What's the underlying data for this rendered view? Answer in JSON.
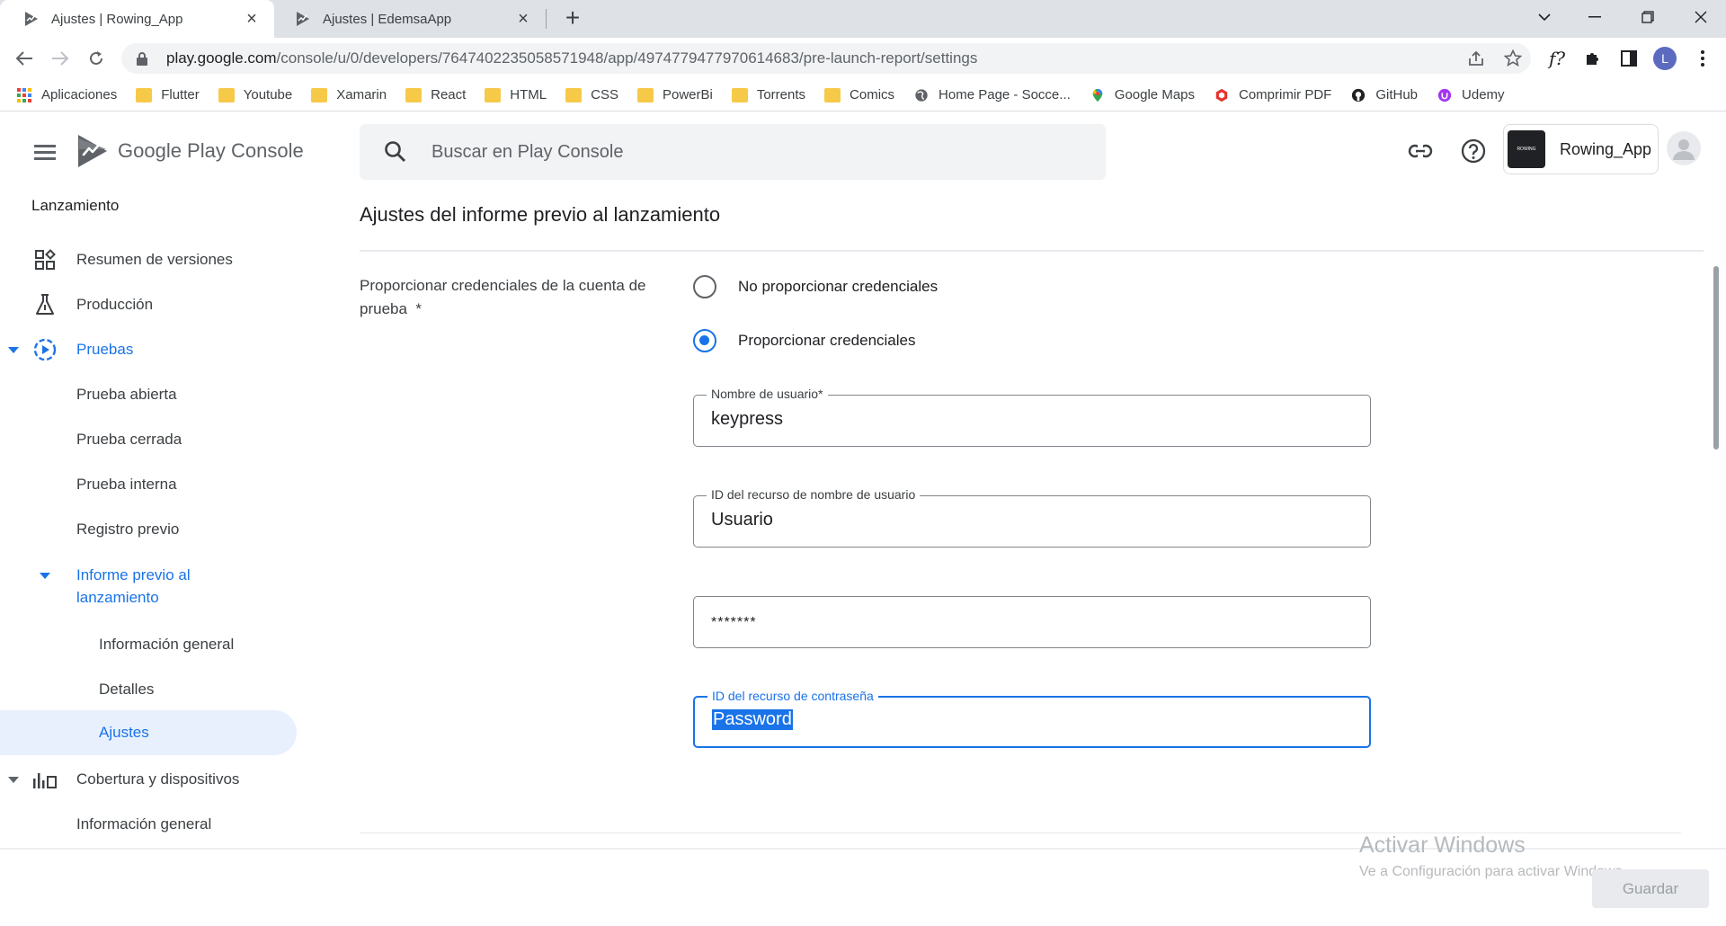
{
  "browser": {
    "tabs": [
      {
        "title": "Ajustes | Rowing_App",
        "active": true
      },
      {
        "title": "Ajustes | EdemsaApp",
        "active": false
      }
    ],
    "url_host": "play.google.com",
    "url_path": "/console/u/0/developers/7647402235058571948/app/4974779477970614683/pre-launch-report/settings",
    "bookmarks": [
      {
        "label": "Aplicaciones",
        "icon": "apps-grid-icon"
      },
      {
        "label": "Flutter",
        "icon": "folder-icon"
      },
      {
        "label": "Youtube",
        "icon": "folder-icon"
      },
      {
        "label": "Xamarin",
        "icon": "folder-icon"
      },
      {
        "label": "React",
        "icon": "folder-icon"
      },
      {
        "label": "HTML",
        "icon": "folder-icon"
      },
      {
        "label": "CSS",
        "icon": "folder-icon"
      },
      {
        "label": "PowerBi",
        "icon": "folder-icon"
      },
      {
        "label": "Torrents",
        "icon": "folder-icon"
      },
      {
        "label": "Comics",
        "icon": "folder-icon"
      },
      {
        "label": "Home Page - Socce...",
        "icon": "globe-icon"
      },
      {
        "label": "Google Maps",
        "icon": "maps-pin-icon"
      },
      {
        "label": "Comprimir PDF",
        "icon": "pdf-icon"
      },
      {
        "label": "GitHub",
        "icon": "github-icon"
      },
      {
        "label": "Udemy",
        "icon": "udemy-icon"
      }
    ],
    "profile_initial": "L"
  },
  "header": {
    "brand_a": "Google Play",
    "brand_b": "Console",
    "search_placeholder": "Buscar en Play Console",
    "app_name": "Rowing_App",
    "app_icon_text": "ROWING"
  },
  "sidebar": {
    "section": "Lanzamiento",
    "items": [
      {
        "label": "Resumen de versiones"
      },
      {
        "label": "Producción"
      },
      {
        "label": "Pruebas"
      },
      {
        "label": "Prueba abierta"
      },
      {
        "label": "Prueba cerrada"
      },
      {
        "label": "Prueba interna"
      },
      {
        "label": "Registro previo"
      },
      {
        "label": "Informe previo al lanzamiento"
      },
      {
        "label": "Información general"
      },
      {
        "label": "Detalles"
      },
      {
        "label": "Ajustes"
      },
      {
        "label": "Cobertura y dispositivos"
      },
      {
        "label": "Información general"
      }
    ]
  },
  "main": {
    "title": "Ajustes del informe previo al lanzamiento",
    "credentials_label": "Proporcionar credenciales de la cuenta de prueba",
    "required_mark": "*",
    "options": [
      {
        "label": "No proporcionar credenciales",
        "selected": false
      },
      {
        "label": "Proporcionar credenciales",
        "selected": true
      }
    ],
    "fields": [
      {
        "label": "Nombre de usuario*",
        "value": "keypress"
      },
      {
        "label": "ID del recurso de nombre de usuario",
        "value": "Usuario"
      },
      {
        "label": "",
        "value": "*******"
      },
      {
        "label": "ID del recurso de contraseña",
        "value": "Password"
      }
    ],
    "save_label": "Guardar"
  },
  "watermark": {
    "line1": "Activar Windows",
    "line2": "Ve a Configuración para activar Windows."
  },
  "colors": {
    "accent": "#1a73e8",
    "selected_bg": "#e8f0fe"
  }
}
